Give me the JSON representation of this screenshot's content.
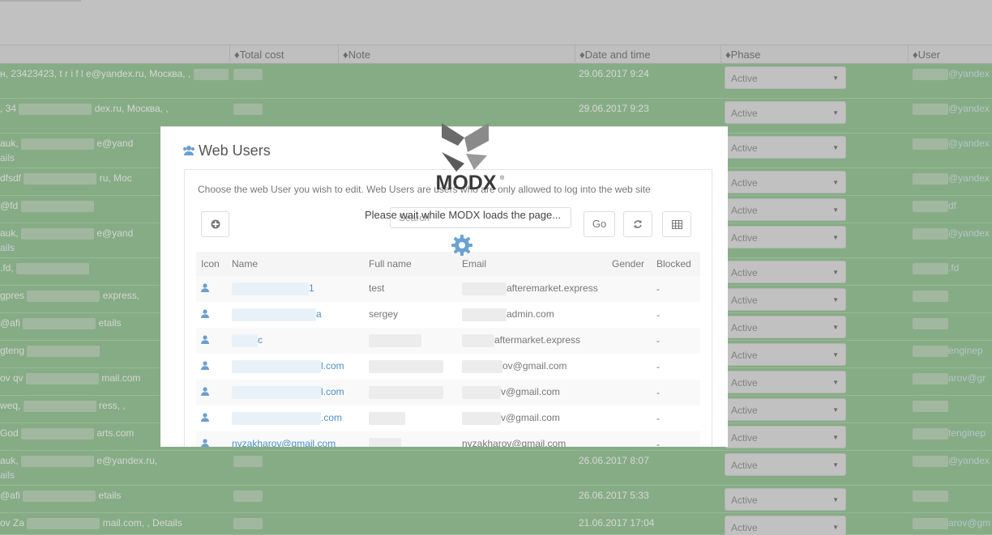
{
  "background": {
    "columns": [
      "♦Total cost",
      "♦Note",
      "♦Date and time",
      "♦Phase",
      "♦User"
    ],
    "rows": [
      {
        "customer": "н, 23423423, t r i f l e@yandex.ru, Москва, ,",
        "extra": "",
        "date": "29.06.2017 9:24",
        "phase": "Active",
        "user": "@yandex"
      },
      {
        "customer": ", 34",
        "customer_end": "dex.ru, Москва, ,",
        "extra": "",
        "date": "29.06.2017 9:23",
        "phase": "Active",
        "user": "@yandex"
      },
      {
        "customer": "auk,",
        "customer_end": "e@yand",
        "extra": "ails",
        "date": "",
        "phase": "Active",
        "user": "@yandex"
      },
      {
        "customer": "dfsdf",
        "customer_end": "ru, Moc",
        "extra": "",
        "date": "",
        "phase": "Active",
        "user": "@yandex"
      },
      {
        "customer": "@fd",
        "customer_end": "",
        "extra": "",
        "date": "",
        "phase": "Active",
        "user": "df"
      },
      {
        "customer": "auk,",
        "customer_end": "e@yand",
        "extra": "ails",
        "date": "",
        "phase": "Active",
        "user": "@yandex"
      },
      {
        "customer": ".fd,",
        "customer_end": "",
        "extra": "",
        "date": "",
        "phase": "Active",
        "user": ".fd"
      },
      {
        "customer": "gpres",
        "customer_end": "express,",
        "extra": "",
        "date": "",
        "phase": "Active",
        "user": ""
      },
      {
        "customer": "@afi",
        "customer_end": "etails",
        "extra": "",
        "date": "",
        "phase": "Active",
        "user": ""
      },
      {
        "customer": "gteng",
        "customer_end": "",
        "extra": "",
        "date": "",
        "phase": "Active",
        "user": "enginep"
      },
      {
        "customer": "ov qv",
        "customer_end": "mail.com",
        "extra": "",
        "date": "",
        "phase": "Active",
        "user": "arov@gr"
      },
      {
        "customer": "weq,",
        "customer_end": "ress, ,",
        "extra": "",
        "date": "",
        "phase": "Active",
        "user": ""
      },
      {
        "customer": "God",
        "customer_end": "arts.com",
        "extra": "",
        "date": "",
        "phase": "Active",
        "user": "tenginep"
      },
      {
        "customer": "auk,",
        "customer_end": "e@yandex.ru,",
        "extra": "ails",
        "date": "26.06.2017 8:07",
        "phase": "Active",
        "user": "@yandex"
      },
      {
        "customer": "@afi",
        "customer_end": "etails",
        "extra": "",
        "date": "26.06.2017 5:33",
        "phase": "Active",
        "user": ""
      },
      {
        "customer": "ov Za",
        "customer_end": "mail.com, , Details",
        "extra": "",
        "date": "21.06.2017 17:04",
        "phase": "Active",
        "user": "arov@gm"
      }
    ]
  },
  "modal": {
    "title": "Web Users",
    "description": "Choose the web User you wish to edit. Web Users are users who are only allowed to log into the web site",
    "search_placeholder": "Search",
    "go_label": "Go",
    "columns": [
      "Icon",
      "Name",
      "Full name",
      "Email",
      "Gender",
      "Blocked"
    ],
    "users": [
      {
        "name": "1",
        "full_name": "test",
        "email": "afteremarket.express",
        "gender": "",
        "blocked": "-"
      },
      {
        "name": "a",
        "full_name": "sergey",
        "email": "admin.com",
        "gender": "",
        "blocked": "-"
      },
      {
        "name": "c",
        "full_name": "",
        "email": "aftermarket.express",
        "gender": "",
        "blocked": "-"
      },
      {
        "name": "l.com",
        "full_name": "",
        "email": "ov@gmail.com",
        "gender": "",
        "blocked": "-"
      },
      {
        "name": "l.com",
        "full_name": "",
        "email": "v@gmail.com",
        "gender": "",
        "blocked": "-"
      },
      {
        "name": ".com",
        "full_name": "",
        "email": "v@gmail.com",
        "gender": "",
        "blocked": "-"
      },
      {
        "name": "nyzakharov@gmail.com",
        "full_name": "",
        "email": "nyzakharov@gmail.com",
        "gender": "",
        "blocked": "-"
      }
    ]
  },
  "loader": {
    "brand": "MODX",
    "message": "Please wait while MODX loads the page..."
  },
  "colors": {
    "row_green": "#7fb97d",
    "link_blue": "#4a90c9",
    "gear_blue": "#6aa3d3"
  }
}
